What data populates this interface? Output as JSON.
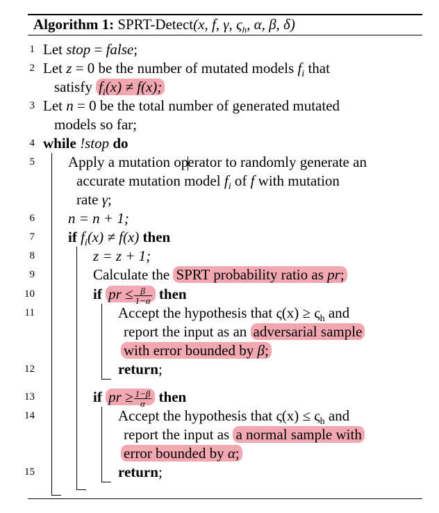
{
  "caption": {
    "label": "Algorithm 1:",
    "name": "SPRT-Detect",
    "params": "(x, f, γ, ς",
    "params_sub": "h",
    "params_tail": ", α, β, δ)"
  },
  "lines": [
    {
      "n": "1",
      "a": "Let ",
      "b": "stop",
      "c": " = ",
      "d": "false",
      "e": ";"
    },
    {
      "n": "2",
      "a": "Let ",
      "b": "z",
      "c": " = 0 be the number of mutated models ",
      "d": "f",
      "d_sub": "i",
      "e": " that"
    },
    {
      "n": "",
      "a": "satisfy ",
      "hl": "f",
      "hl_sub": "i",
      "hl_tail": "(x) ≠ f(x);"
    },
    {
      "n": "3",
      "a": "Let ",
      "b": "n",
      "c": " = 0 be the total number of generated mutated"
    },
    {
      "n": "",
      "a": "models so far;"
    },
    {
      "n": "4",
      "kw1": "while ",
      "b": "!stop",
      "kw2": " do"
    },
    {
      "n": "5",
      "a1": "Apply a mutation op",
      "a2": "erator to randomly generate an"
    },
    {
      "n": "",
      "a": "accurate mutation model ",
      "b": "f",
      "b_sub": "i",
      "c": " of ",
      "d": "f",
      "e": " with mutation"
    },
    {
      "n": "",
      "a": "rate ",
      "b": "γ",
      "c": ";"
    },
    {
      "n": "6",
      "a": "n = n + 1;"
    },
    {
      "n": "7",
      "kw1": "if ",
      "b": "f",
      "b_sub": "i",
      "c": "(x) ≠ f(x) ",
      "kw2": "then"
    },
    {
      "n": "8",
      "a": "z = z + 1;"
    },
    {
      "n": "9",
      "a": "Calculate the ",
      "hl": "SPRT probability ratio as ",
      "hl_i": "pr",
      "hl_tail": ";"
    },
    {
      "n": "10",
      "kw1": "if ",
      "hl": "pr ≤",
      "num": "β",
      "den": "1−α",
      "kw2": " then"
    },
    {
      "n": "11",
      "a": "Accept the hypothesis that ς(x) ≥ ς",
      "a_sub": "h",
      "b": " and"
    },
    {
      "n": "",
      "a": "report the input as an ",
      "hl": "adversarial sample"
    },
    {
      "n": "",
      "hl": "with error bounded by ",
      "hl_i": "β",
      "hl_tail": ";"
    },
    {
      "n": "12",
      "kw": "return",
      "a": ";"
    },
    {
      "n": "13",
      "kw1": "if ",
      "hl": "pr ≥",
      "num": "1−β",
      "den": "α",
      "kw2": " then"
    },
    {
      "n": "14",
      "a": "Accept the hypothesis that ς(x) ≤ ς",
      "a_sub": "h",
      "b": " and"
    },
    {
      "n": "",
      "a": "report the input as ",
      "hl": "a normal sample with"
    },
    {
      "n": "",
      "hl": "error bounded by ",
      "hl_i": "α",
      "hl_tail": ";"
    },
    {
      "n": "15",
      "kw": "return",
      "a": ";"
    }
  ]
}
